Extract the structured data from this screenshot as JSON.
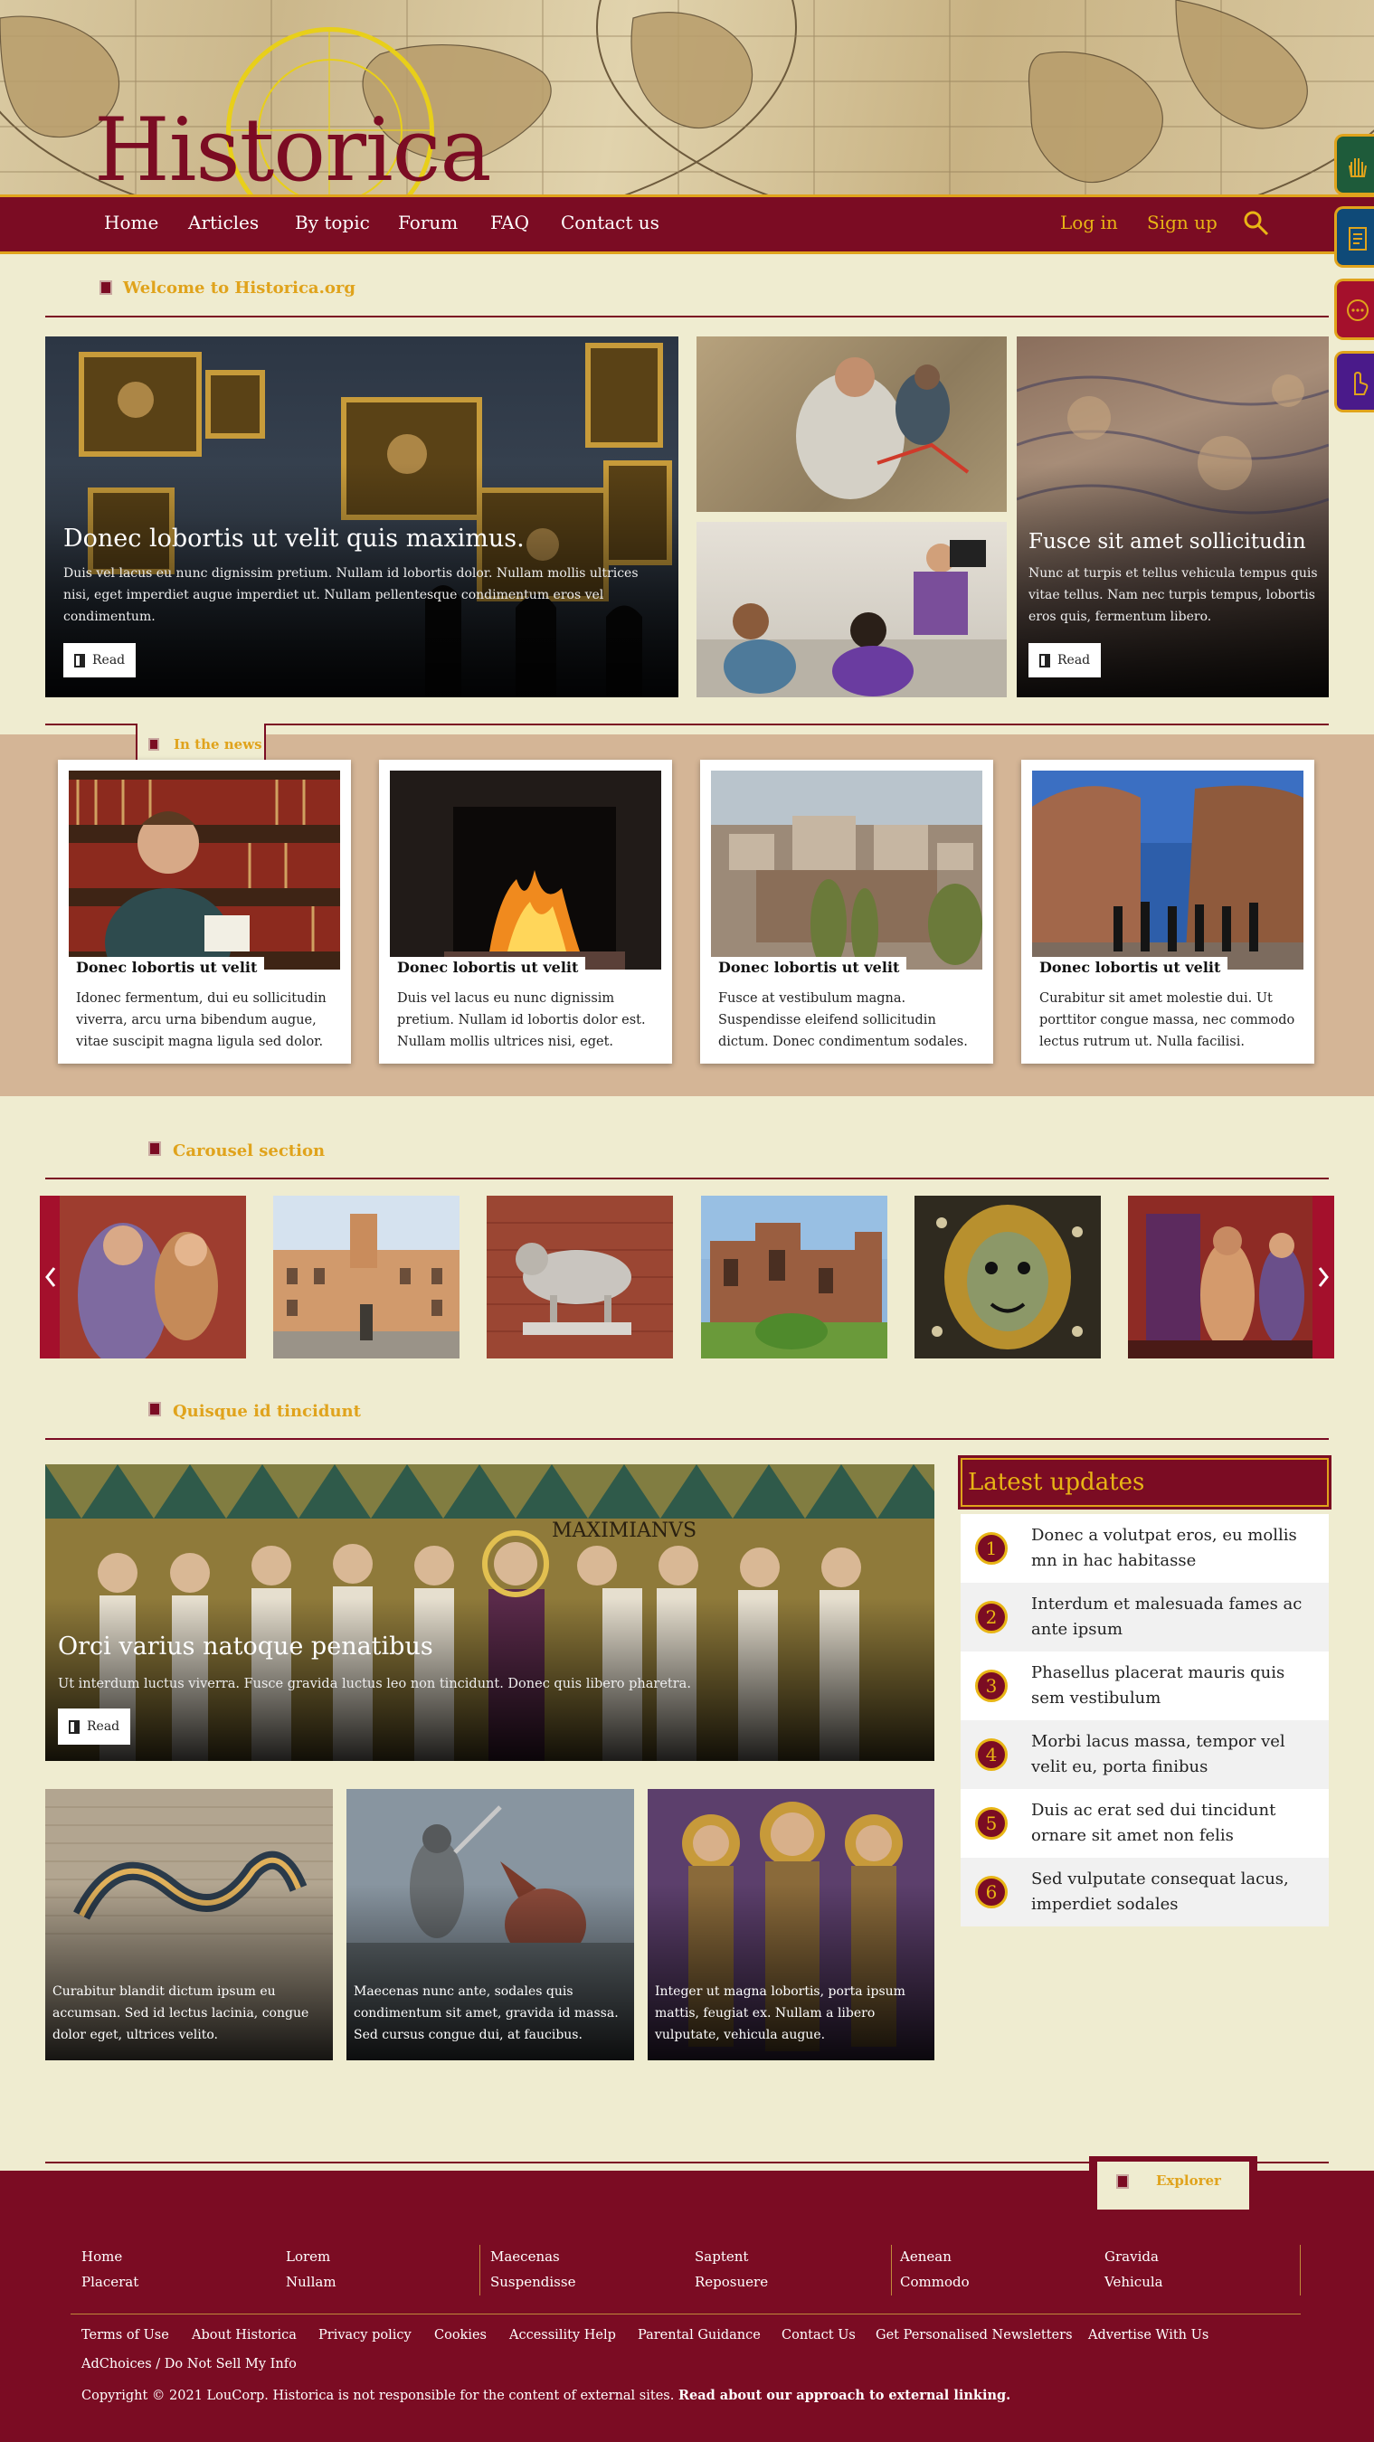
{
  "site": {
    "logo_text": "Historica"
  },
  "nav": {
    "items": [
      "Home",
      "Articles",
      "By topic",
      "Forum",
      "FAQ",
      "Contact us"
    ],
    "login": "Log in",
    "signup": "Sign up"
  },
  "welcome": {
    "title": "Welcome to Historica.org",
    "hero_main": {
      "title": "Donec lobortis ut velit quis maximus.",
      "text": "Duis vel lacus eu nunc dignissim pretium. Nullam id lobortis dolor. Nullam mollis ultrices nisi, eget imperdiet augue imperdiet ut. Nullam pellentesque condimentum eros vel condimentum.",
      "button": "Read"
    },
    "hero_side": {
      "title": "Fusce sit amet sollicitudin",
      "text": "Nunc at turpis et tellus vehicula tempus quis vitae tellus. Nam nec turpis tempus, lobortis eros quis, fermentum libero.",
      "button": "Read"
    }
  },
  "news": {
    "title": "In the news",
    "cards": [
      {
        "title": "Donec lobortis ut velit",
        "text": "Idonec fermentum, dui eu sollicitudin viverra, arcu urna bibendum augue, vitae suscipit magna ligula sed dolor."
      },
      {
        "title": "Donec lobortis ut velit",
        "text": "Duis vel lacus eu nunc dignissim pretium. Nullam id lobortis dolor est. Nullam mollis ultrices nisi, eget."
      },
      {
        "title": "Donec lobortis ut velit",
        "text": "Fusce at vestibulum magna. Suspendisse eleifend sollicitudin dictum. Donec condimentum sodales."
      },
      {
        "title": "Donec lobortis ut velit",
        "text": "Curabitur sit amet molestie dui. Ut porttitor congue massa, nec commodo lectus rutrum ut. Nulla facilisi."
      }
    ]
  },
  "carousel": {
    "title": "Carousel section"
  },
  "quisque": {
    "title": "Quisque id tincidunt",
    "feature": {
      "title": "Orci varius natoque penatibus",
      "text": "Ut interdum luctus viverra. Fusce gravida luctus leo non tincidunt. Donec quis libero pharetra.",
      "button": "Read",
      "mosaic_text": "MAXIMIANVS"
    },
    "tiles": [
      {
        "text": "Curabitur blandit dictum ipsum eu accumsan. Sed id lectus lacinia, congue dolor eget, ultrices velito."
      },
      {
        "text": "Maecenas nunc ante, sodales quis condimentum sit amet, gravida id massa. Sed cursus congue dui, at faucibus."
      },
      {
        "text": "Integer ut magna lobortis, porta ipsum mattis, feugiat ex. Nullam a libero vulputate, vehicula augue."
      }
    ]
  },
  "latest": {
    "title": "Latest updates",
    "items": [
      {
        "num": "1",
        "text": "Donec a volutpat eros, eu mollis mn in hac habitasse"
      },
      {
        "num": "2",
        "text": "Interdum et malesuada fames ac ante ipsum"
      },
      {
        "num": "3",
        "text": "Phasellus placerat mauris quis sem vestibulum"
      },
      {
        "num": "4",
        "text": "Morbi lacus massa, tempor vel velit eu, porta finibus"
      },
      {
        "num": "5",
        "text": "Duis ac erat sed dui tincidunt ornare sit amet non felis"
      },
      {
        "num": "6",
        "text": "Sed vulputate consequat lacus, imperdiet sodales"
      }
    ]
  },
  "footer": {
    "explorer": "Explorer",
    "columns": [
      [
        "Home",
        "Placerat"
      ],
      [
        "Lorem",
        "Nullam"
      ],
      [
        "Maecenas",
        "Suspendisse"
      ],
      [
        "Saptent",
        "Reposuere"
      ],
      [
        "Aenean",
        "Commodo"
      ],
      [
        "Gravida",
        "Vehicula"
      ]
    ],
    "legal": [
      "Terms of Use",
      "About Historica",
      "Privacy policy",
      "Cookies",
      "Accessility Help",
      "Parental Guidance",
      "Contact Us",
      "Get Personalised Newsletters",
      "Advertise With Us"
    ],
    "adchoices": "AdChoices / Do Not Sell My Info",
    "copyright": "Copyright © 2021 LouCorp. Historica is not responsible for the content of external sites.",
    "copyright_bold": "Read about our approach to external linking."
  },
  "colors": {
    "primary": "#7b0c23",
    "accent": "#e0a31c",
    "background": "#efecd0",
    "news_band": "#d4b596"
  }
}
